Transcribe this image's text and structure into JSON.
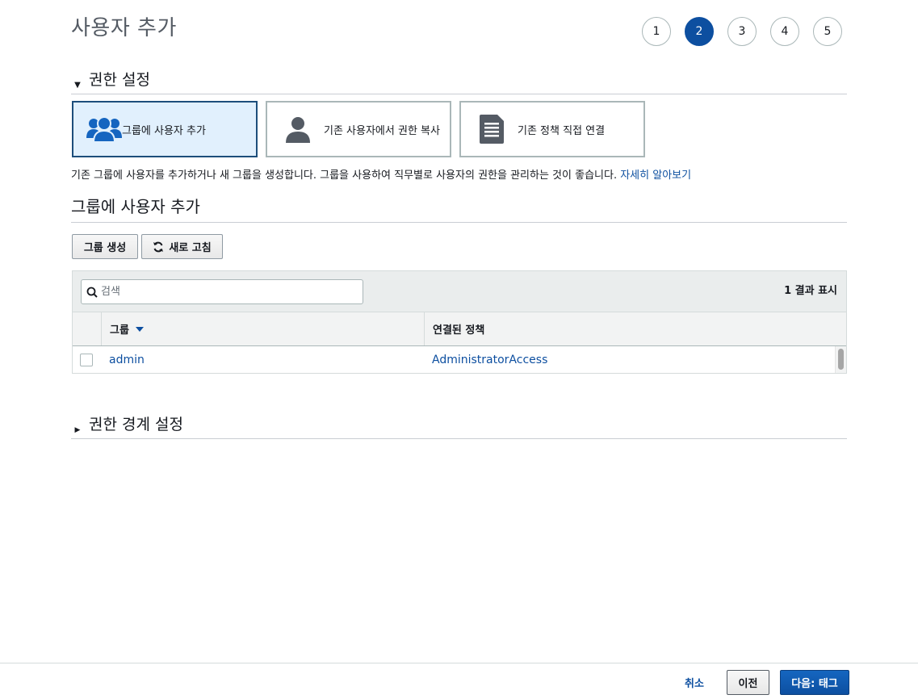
{
  "page": {
    "title": "사용자 추가"
  },
  "steps": [
    {
      "label": "1",
      "active": false
    },
    {
      "label": "2",
      "active": true
    },
    {
      "label": "3",
      "active": false
    },
    {
      "label": "4",
      "active": false
    },
    {
      "label": "5",
      "active": false
    }
  ],
  "permissions_section": {
    "caret": "▼",
    "title": "권한 설정",
    "options": [
      {
        "label": "그룹에 사용자 추가",
        "icon": "users-group-icon",
        "selected": true
      },
      {
        "label": "기존 사용자에서 권한 복사",
        "icon": "user-icon",
        "selected": false
      },
      {
        "label": "기존 정책 직접 연결",
        "icon": "document-icon",
        "selected": false
      }
    ],
    "description": "기존 그룹에 사용자를 추가하거나 새 그룹을 생성합니다. 그룹을 사용하여 직무별로 사용자의 권한을 관리하는 것이 좋습니다. ",
    "learn_more": "자세히 알아보기"
  },
  "group_section": {
    "title": "그룹에 사용자 추가",
    "create_group_button": "그룹 생성",
    "refresh_button": "새로 고침",
    "search_placeholder": "검색",
    "result_count": "1 결과 표시",
    "columns": {
      "group": "그룹",
      "policy": "연결된 정책"
    },
    "rows": [
      {
        "group": "admin",
        "policy": "AdministratorAccess",
        "checked": false
      }
    ]
  },
  "boundary_section": {
    "caret": "▶",
    "title": "권한 경계 설정"
  },
  "footer": {
    "cancel": "취소",
    "previous": "이전",
    "next": "다음: 태그"
  },
  "colors": {
    "accent": "#0d4fa0",
    "selected_card_bg": "#e1f0fd",
    "selected_card_border": "#1d4e7b"
  }
}
